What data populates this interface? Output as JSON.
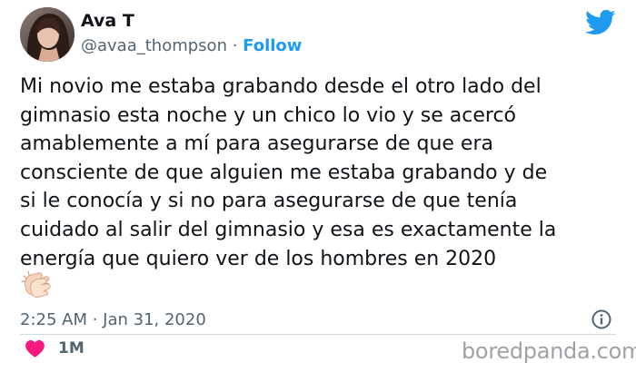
{
  "author": {
    "name": "Ava T",
    "handle": "@avaa_thompson",
    "separator": " · ",
    "follow_label": "Follow"
  },
  "tweet": {
    "lines": [
      "Mi novio me estaba grabando desde el otro lado del",
      "gimnasio esta noche y un chico lo vio y se acercó",
      "amablemente a mí para asegurarse de que era",
      "consciente de que alguien me estaba grabando y de",
      "si le conocía y si no para asegurarse de que tenía",
      "cuidado al salir del gimnasio y esa es exactamente la",
      "energía que quiero ver de los hombres en 2020"
    ],
    "emoji": "clapping-hands"
  },
  "meta": {
    "timestamp": "2:25 AM · Jan 31, 2020"
  },
  "actions": {
    "like_count": "1M"
  },
  "watermark": {
    "text": "boredpanda.com"
  },
  "icons": {
    "brand": "twitter-bird-icon",
    "info": "info-icon",
    "like": "heart-icon"
  },
  "colors": {
    "twitter_blue": "#1d9bf0",
    "like_pink": "#f91880",
    "secondary_text": "#536471",
    "watermark_gray": "#9ea3a8"
  }
}
